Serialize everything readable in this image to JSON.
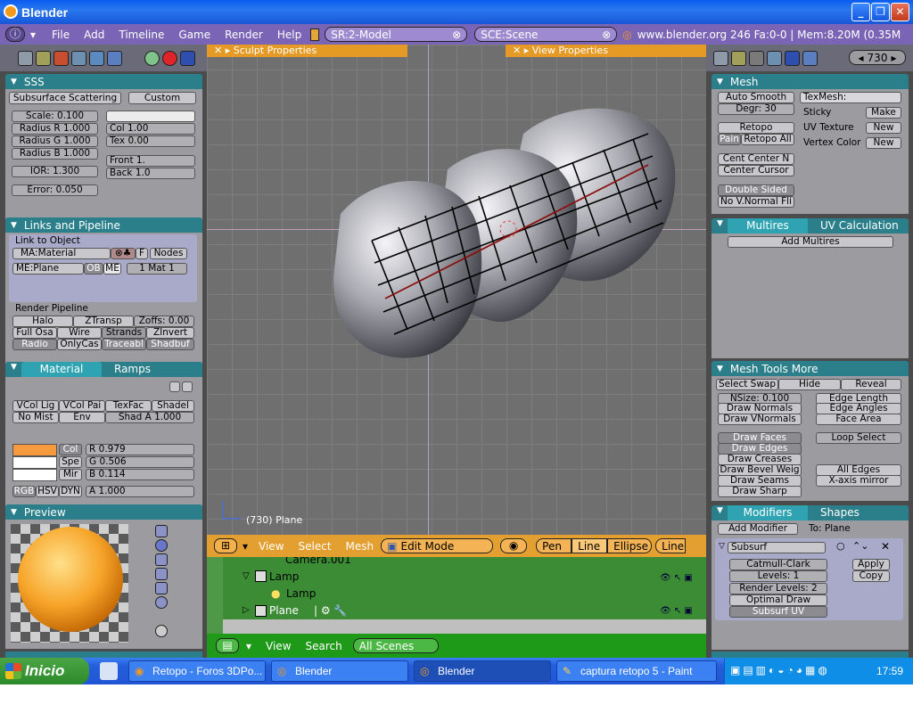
{
  "window": {
    "title": "Blender"
  },
  "top": {
    "menus": [
      "File",
      "Add",
      "Timeline",
      "Game",
      "Render",
      "Help"
    ],
    "screen": "SR:2-Model",
    "scene": "SCE:Scene",
    "info": "www.blender.org 246   Fa:0-0 | Mem:8.20M (0.35M"
  },
  "left": {
    "sss": {
      "title": "SSS",
      "mode": "Subsurface Scattering",
      "preset": "Custom",
      "scale": "Scale: 0.100",
      "radius_r": "Radius R 1.000",
      "radius_g": "Radius G 1.000",
      "radius_b": "Radius B 1.000",
      "ior": "IOR: 1.300",
      "error": "Error: 0.050",
      "col": "Col 1.00",
      "tex": "Tex 0.00",
      "front": "Front 1.",
      "back": "Back 1.0"
    },
    "links": {
      "title": "Links and Pipeline",
      "link_label": "Link to Object",
      "material": "MA:Material",
      "f": "F",
      "nodes": "Nodes",
      "me": "ME:Plane",
      "ob": "OB",
      "me_btn": "ME",
      "mat": "1 Mat 1",
      "pipeline": "Render Pipeline",
      "halo": "Halo",
      "ztransp": "ZTransp",
      "zoffs": "Zoffs: 0.00",
      "fullosa": "Full Osa",
      "wire": "Wire",
      "strands": "Strands",
      "zinvert": "ZInvert",
      "radio": "Radio",
      "onlycas": "OnlyCas",
      "traceabl": "Traceabl",
      "shadbuf": "Shadbuf"
    },
    "material": {
      "tab1": "Material",
      "tab2": "Ramps",
      "vcollig": "VCol Lig",
      "vcolpai": "VCol Pai",
      "texfac": "TexFac",
      "shadel": "Shadel",
      "nomist": "No Mist",
      "env": "Env",
      "shada": "Shad A 1.000",
      "col": "Col",
      "spe": "Spe",
      "mir": "Mir",
      "r": "R 0.979",
      "g": "G 0.506",
      "b": "B 0.114",
      "rgb": "RGB",
      "hsv": "HSV",
      "dyn": "DYN",
      "a": "A 1.000",
      "swatch": "#f79a3e"
    },
    "preview": {
      "title": "Preview"
    }
  },
  "viewport": {
    "sculpt": "Sculpt Properties",
    "view": "View Properties",
    "obj_label": "(730) Plane"
  },
  "vp_header": {
    "view": "View",
    "select": "Select",
    "mesh": "Mesh",
    "mode": "Edit Mode",
    "pen": "Pen",
    "line": "Line",
    "ellipse": "Ellipse",
    "line2": "Line"
  },
  "outliner": {
    "items": [
      "Camera.001",
      "Lamp",
      "Lamp",
      "Plane"
    ],
    "view": "View",
    "search": "Search",
    "scope": "All Scenes"
  },
  "right": {
    "frame": "730",
    "mesh": {
      "title": "Mesh",
      "autosmooth": "Auto Smooth",
      "degr": "Degr: 30",
      "texmesh": "TexMesh:",
      "sticky": "Sticky",
      "make": "Make",
      "uvtex": "UV Texture",
      "new1": "New",
      "vcolor": "Vertex Color",
      "new2": "New",
      "retopo": "Retopo",
      "pain": "Pain",
      "retopoall": "Retopo All",
      "centn": "Cent Center N",
      "cursor": "Center Cursor",
      "double": "Double Sided",
      "novnormal": "No V.Normal Fli"
    },
    "multires": {
      "tab1": "Multires",
      "tab2": "UV Calculation",
      "add": "Add Multires"
    },
    "tools": {
      "title": "Mesh Tools More",
      "swap": "Select Swap",
      "hide": "Hide",
      "reveal": "Reveal",
      "nsize": "NSize: 0.100",
      "edgelen": "Edge Length",
      "drawnormals": "Draw Normals",
      "edgeang": "Edge Angles",
      "drawvnormals": "Draw VNormals",
      "facearea": "Face Area",
      "drawfaces": "Draw Faces",
      "loopselect": "Loop Select",
      "drawedges": "Draw Edges",
      "drawcreases": "Draw Creases",
      "drawbevel": "Draw Bevel Weig",
      "alledges": "All Edges",
      "drawseams": "Draw Seams",
      "xmirror": "X-axis mirror",
      "drawsharp": "Draw Sharp"
    },
    "modifiers": {
      "tab1": "Modifiers",
      "tab2": "Shapes",
      "add": "Add Modifier",
      "to": "To: Plane",
      "name": "Subsurf",
      "catmull": "Catmull-Clark",
      "levels": "Levels: 1",
      "render": "Render Levels: 2",
      "optimal": "Optimal Draw",
      "subsurfuv": "Subsurf UV",
      "apply": "Apply",
      "copy": "Copy"
    }
  },
  "taskbar": {
    "start": "Inicio",
    "tasks": [
      "Retopo - Foros 3DPo...",
      "Blender",
      "Blender",
      "captura retopo 5 - Paint"
    ],
    "time": "17:59"
  }
}
